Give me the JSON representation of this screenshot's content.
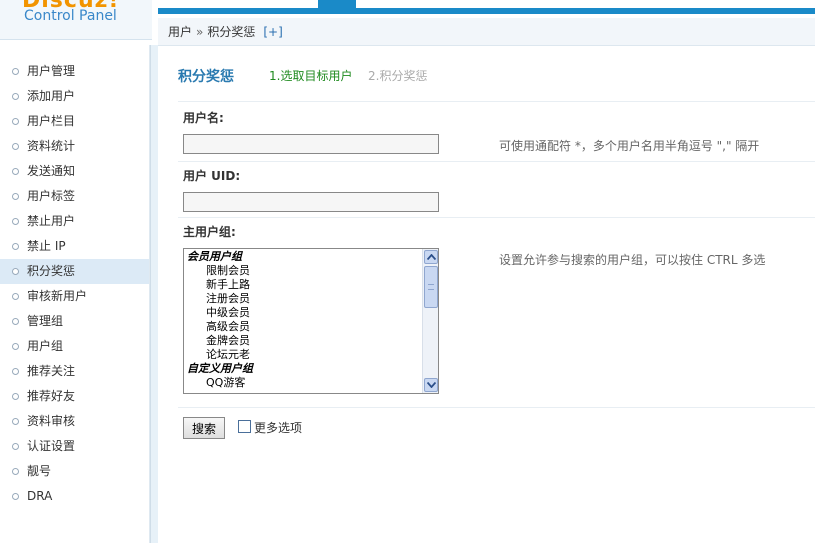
{
  "header": {
    "brand": "Discuz!",
    "subtitle": "Control Panel"
  },
  "breadcrumb": {
    "root": "用户",
    "separator": "»",
    "current": "积分奖惩",
    "add": "[+]"
  },
  "sidebar": {
    "items": [
      {
        "label": "用户管理"
      },
      {
        "label": "添加用户"
      },
      {
        "label": "用户栏目"
      },
      {
        "label": "资料统计"
      },
      {
        "label": "发送通知"
      },
      {
        "label": "用户标签"
      },
      {
        "label": "禁止用户"
      },
      {
        "label": "禁止 IP"
      },
      {
        "label": "积分奖惩",
        "active": true
      },
      {
        "label": "审核新用户"
      },
      {
        "label": "管理组"
      },
      {
        "label": "用户组"
      },
      {
        "label": "推荐关注"
      },
      {
        "label": "推荐好友"
      },
      {
        "label": "资料审核"
      },
      {
        "label": "认证设置"
      },
      {
        "label": "靓号"
      },
      {
        "label": "DRA"
      }
    ]
  },
  "main": {
    "title": "积分奖惩",
    "step1": "1.选取目标用户",
    "step2": "2.积分奖惩",
    "username": {
      "label": "用户名:",
      "value": "",
      "hint": "可使用通配符 *，多个用户名用半角逗号 \",\" 隔开"
    },
    "uid": {
      "label": "用户 UID:",
      "value": ""
    },
    "groups": {
      "label": "主用户组:",
      "hint": "设置允许参与搜索的用户组，可以按住 CTRL 多选",
      "member_group_head": "会员用户组",
      "member_groups": [
        "限制会员",
        "新手上路",
        "注册会员",
        "中级会员",
        "高级会员",
        "金牌会员",
        "论坛元老"
      ],
      "custom_group_head": "自定义用户组",
      "custom_groups": [
        "QQ游客"
      ]
    },
    "search_label": "搜索",
    "more_options_label": "更多选项"
  }
}
